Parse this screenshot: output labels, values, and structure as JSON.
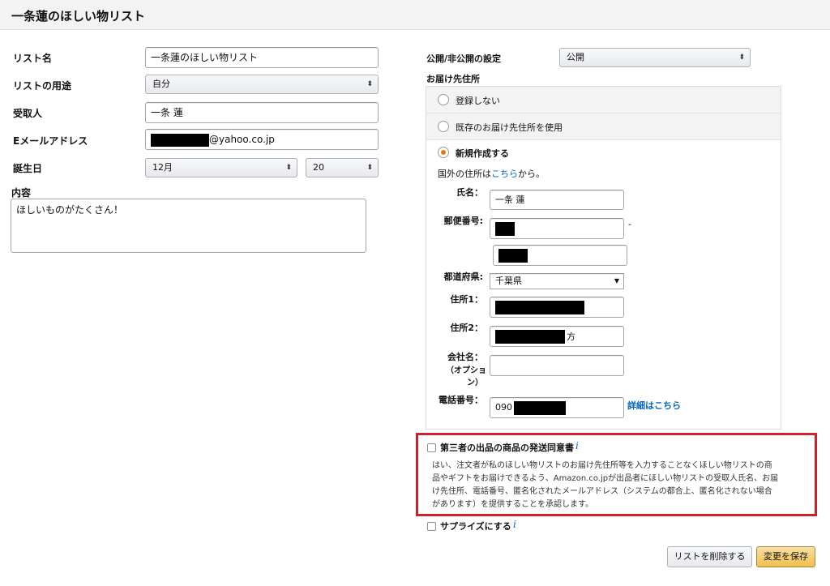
{
  "header": {
    "title": "一条蓮のほしい物リスト"
  },
  "left": {
    "list_name_label": "リスト名",
    "list_name_value": "一条蓮のほしい物リスト",
    "purpose_label": "リストの用途",
    "purpose_value": "自分",
    "recipient_label": "受取人",
    "recipient_value": "一条 蓮",
    "email_label": "Eメールアドレス",
    "email_suffix": "@yahoo.co.jp",
    "birthday_label": "誕生日",
    "birthday_month": "12月",
    "birthday_day": "20",
    "content_label": "内容",
    "content_value": "ほしいものがたくさん！"
  },
  "right": {
    "visibility_label": "公開/非公開の設定",
    "visibility_value": "公開",
    "address_label": "お届け先住所",
    "options": [
      {
        "label": "登録しない",
        "selected": false
      },
      {
        "label": "既存のお届け先住所を使用",
        "selected": false
      },
      {
        "label": "新規作成する",
        "selected": true
      }
    ],
    "overseas_prefix": "国外の住所は",
    "overseas_link": "こちら",
    "overseas_suffix": "から。",
    "name_label": "氏名：",
    "name_value": "一条 蓮",
    "postal_label": "郵便番号:",
    "postal_dash": "-",
    "prefecture_label": "都道府県:",
    "prefecture_value": "千葉県",
    "address1_label": "住所1：",
    "address2_label": "住所2：",
    "address2_suffix": "方",
    "company_label_1": "会社名：",
    "company_label_2": "（オプショ",
    "company_label_3": "ン）",
    "phone_label": "電話番号：",
    "phone_prefix": "090",
    "phone_details_link": "詳細はこちら"
  },
  "consent": {
    "title": "第三者の出品の商品の発送同意書",
    "info_glyph": "i",
    "line1": "はい、注文者が私のほしい物リストのお届け先住所等を入力することなくほしい物リストの商",
    "line2": "品やギフトをお届けできるよう、Amazon.co.jpが出品者にほしい物リストの受取人氏名、お届",
    "line3": "け先住所、電話番号、匿名化されたメールアドレス（システムの都合上、匿名化されない場合",
    "line4": "があります）を提供することを承認します。",
    "highlight_color": "#d0202a"
  },
  "surprise": {
    "label": "サプライズにする",
    "info_glyph": "i"
  },
  "actions": {
    "delete_label": "リストを削除する",
    "save_label": "変更を保存"
  }
}
